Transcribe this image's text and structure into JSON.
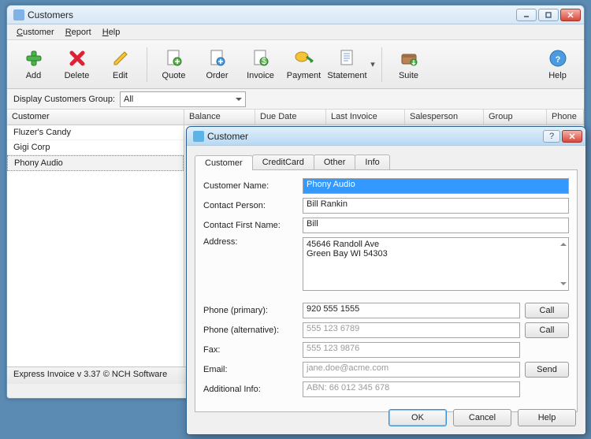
{
  "window": {
    "title": "Customers"
  },
  "menu": {
    "customer": "Customer",
    "report": "Report",
    "help": "Help"
  },
  "toolbar": {
    "add": "Add",
    "delete": "Delete",
    "edit": "Edit",
    "quote": "Quote",
    "order": "Order",
    "invoice": "Invoice",
    "payment": "Payment",
    "statement": "Statement",
    "suite": "Suite",
    "help": "Help"
  },
  "filter": {
    "label": "Display Customers Group:",
    "value": "All"
  },
  "columns": {
    "customer": "Customer",
    "balance": "Balance",
    "due_date": "Due Date",
    "last_invoice": "Last Invoice",
    "salesperson": "Salesperson",
    "group": "Group",
    "phone": "Phone"
  },
  "customers": {
    "header": "Customer",
    "items": [
      {
        "name": "Fluzer's Candy"
      },
      {
        "name": "Gigi Corp"
      },
      {
        "name": "Phony Audio",
        "selected": true
      }
    ]
  },
  "status": "Express Invoice v 3.37  © NCH Software",
  "dialog": {
    "title": "Customer",
    "tabs": {
      "customer": "Customer",
      "creditcard": "CreditCard",
      "other": "Other",
      "info": "Info"
    },
    "labels": {
      "customer_name": "Customer Name:",
      "contact_person": "Contact Person:",
      "contact_first": "Contact First Name:",
      "address": "Address:",
      "phone_primary": "Phone (primary):",
      "phone_alt": "Phone (alternative):",
      "fax": "Fax:",
      "email": "Email:",
      "additional": "Additional Info:"
    },
    "values": {
      "customer_name": "Phony Audio",
      "contact_person": "Bill Rankin",
      "contact_first": "Bill",
      "address_line1": "45646 Randoll Ave",
      "address_line2": "Green Bay WI 54303",
      "phone_primary": "920 555 1555",
      "phone_alt": "555 123 6789",
      "fax": "555 123 9876",
      "email": "jane.doe@acme.com",
      "additional": "ABN: 66 012 345 678"
    },
    "buttons": {
      "call": "Call",
      "send": "Send",
      "ok": "OK",
      "cancel": "Cancel",
      "help": "Help"
    }
  }
}
